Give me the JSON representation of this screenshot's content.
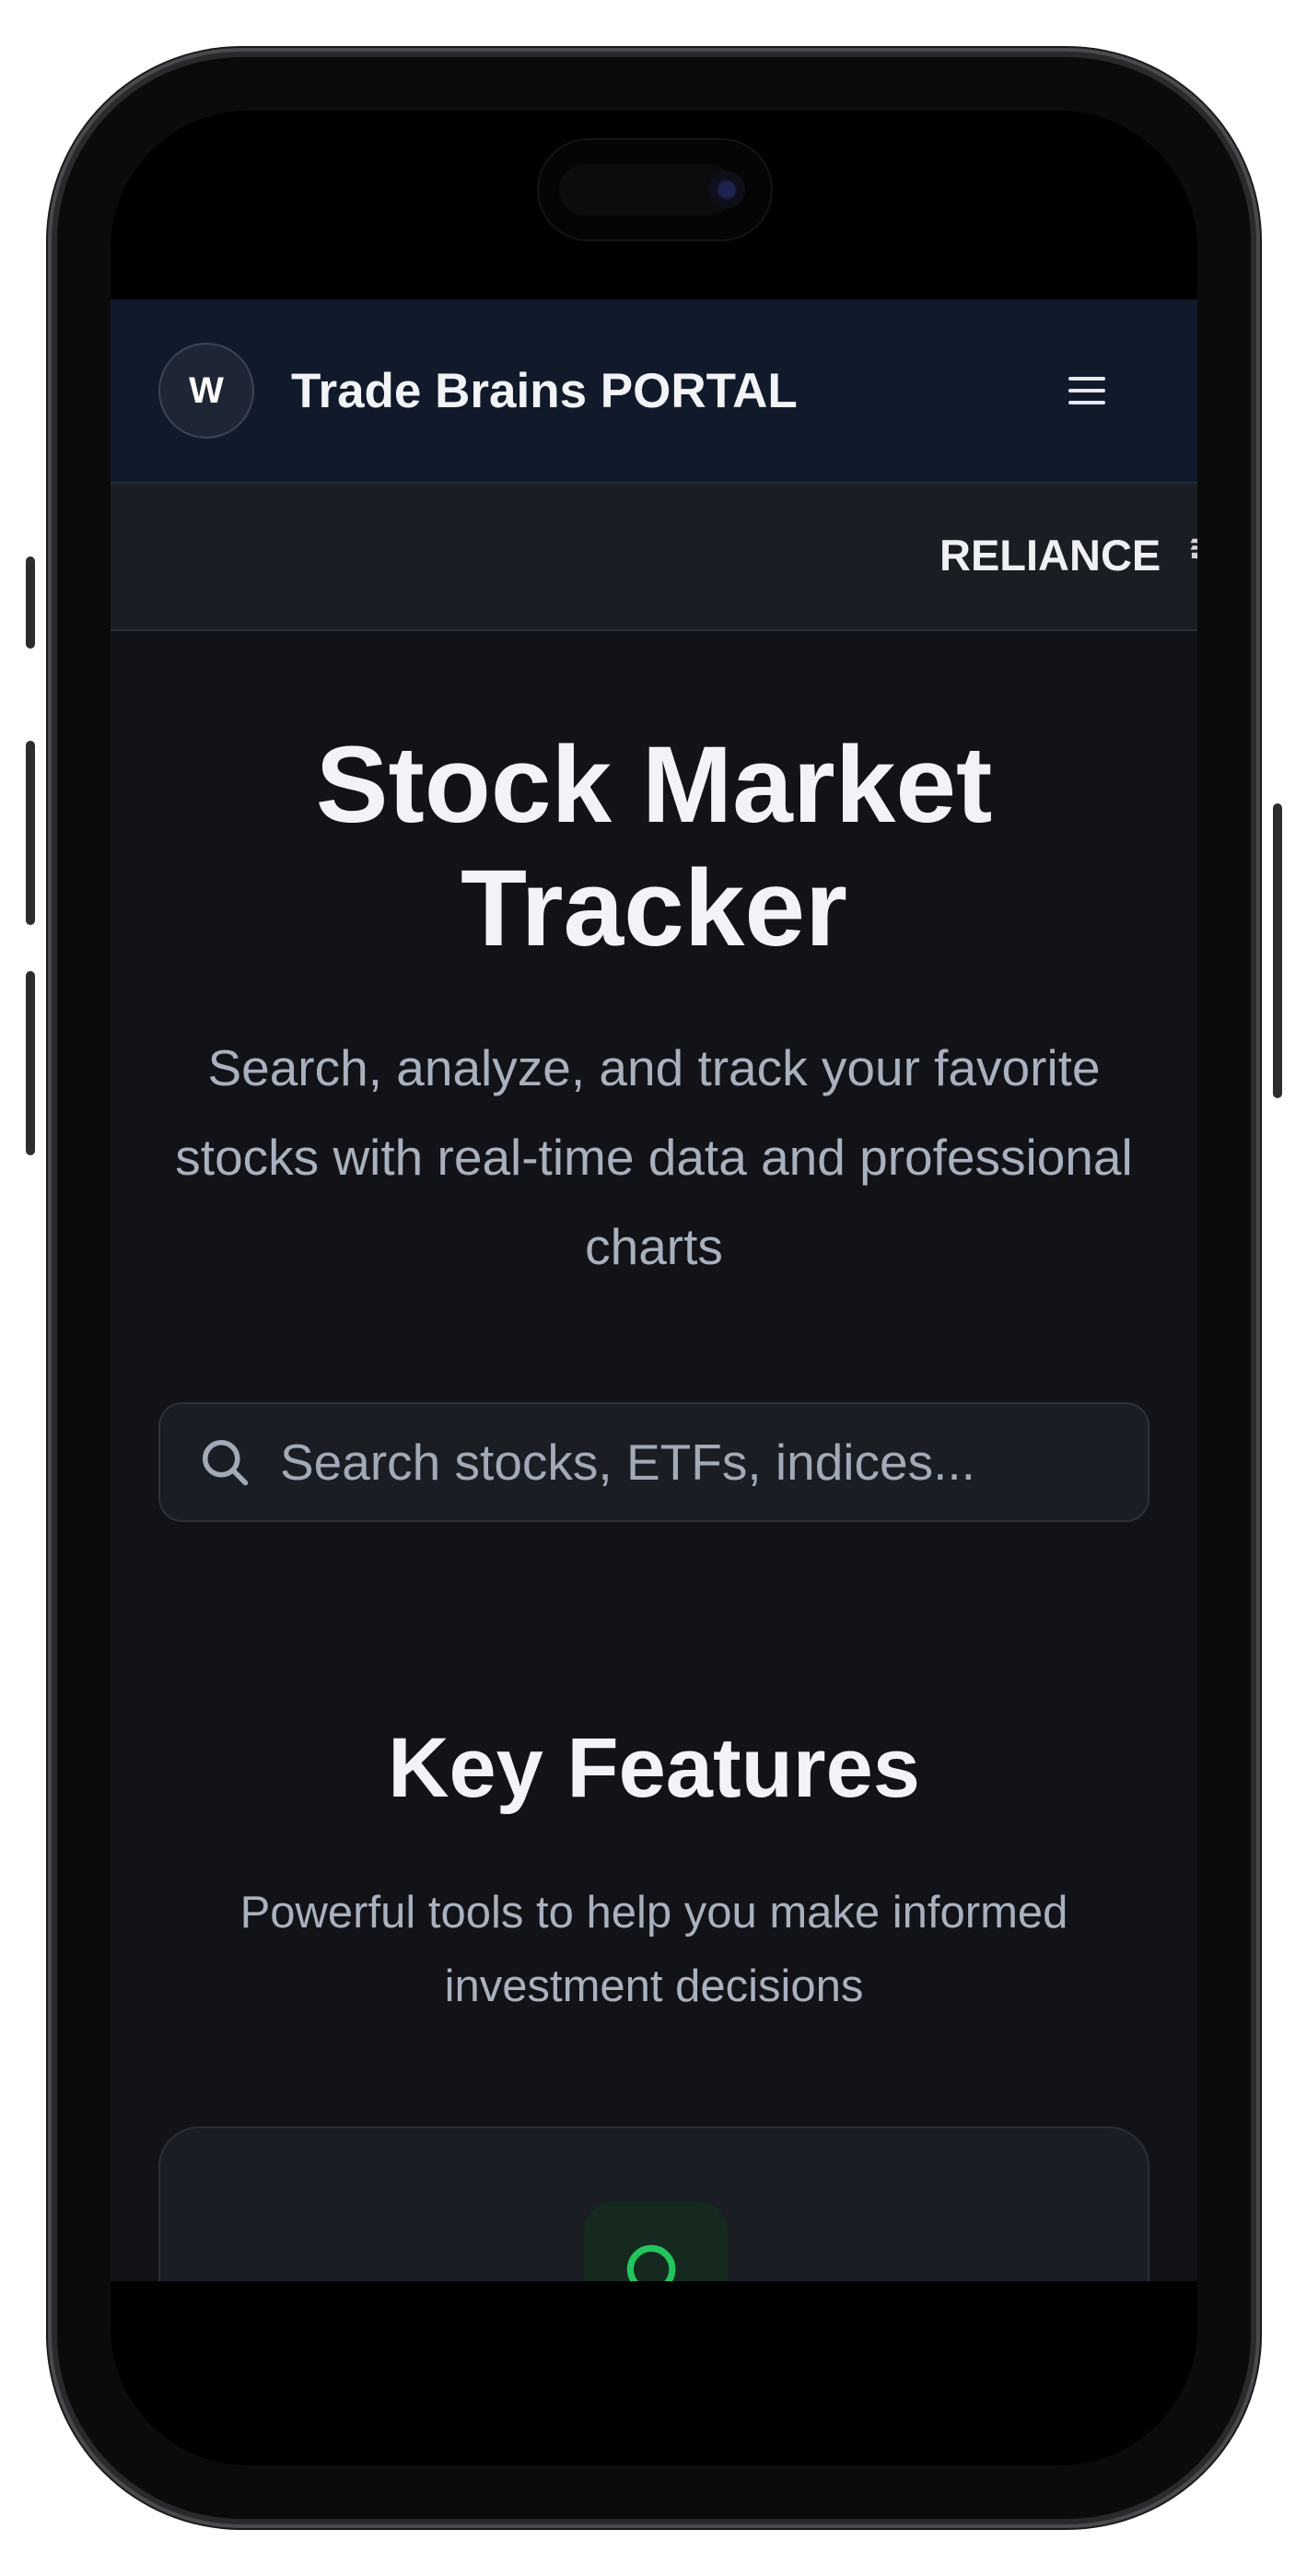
{
  "nav": {
    "logo_letter": "W",
    "brand": "Trade Brains PORTAL"
  },
  "ticker": {
    "symbol": "RELIANCE",
    "price_prefix": "₹"
  },
  "hero": {
    "title": "Stock Market Tracker",
    "subtitle": "Search, analyze, and track your favorite stocks with real-time data and professional charts"
  },
  "search": {
    "placeholder": "Search stocks, ETFs, indices..."
  },
  "features": {
    "title": "Key Features",
    "subtitle": "Powerful tools to help you make informed investment decisions"
  },
  "colors": {
    "background": "#111318",
    "nav": "#111a2b",
    "accent_green": "#22c55e"
  },
  "icons": {
    "menu": "hamburger-menu-icon",
    "search": "search-icon",
    "feature": "search-icon"
  }
}
